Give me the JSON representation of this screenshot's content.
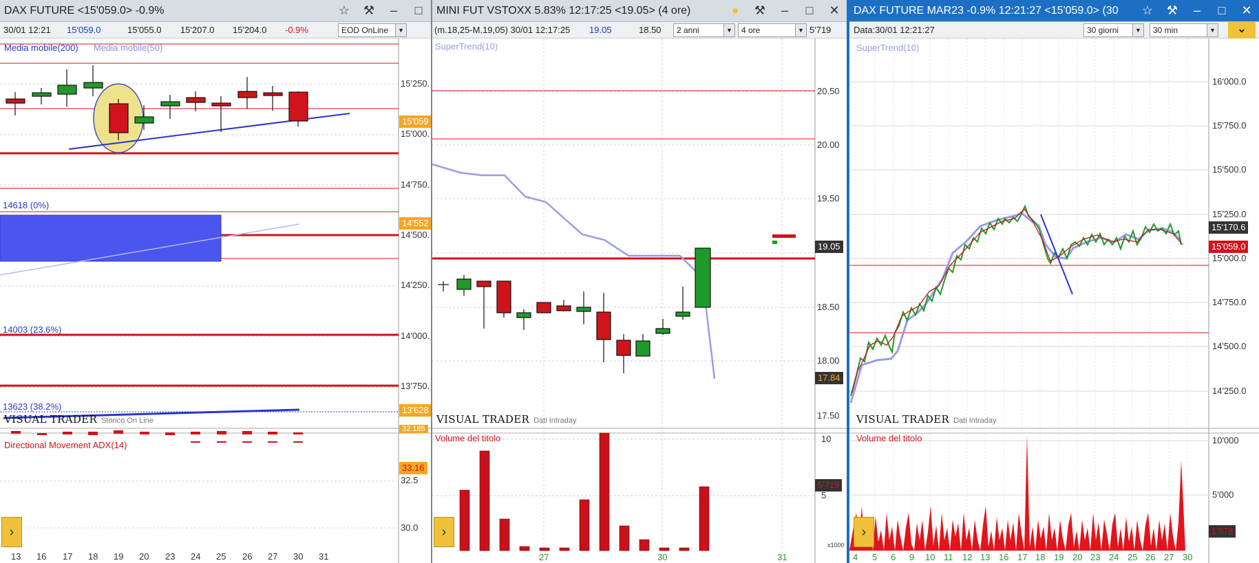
{
  "panels": {
    "dax": {
      "title": "DAX FUTURE <15'059.0> -0.9%",
      "info": {
        "date": "30/01 12:21",
        "last": "15'059.0",
        "v2": "15'055.0",
        "v3": "15'207.0",
        "v4": "15'204.0",
        "change": "-0.9%"
      },
      "source_select": "EOD OnLine",
      "indicator_ma200": "Media mobile(200)",
      "indicator_ma50": "Media mobile(50)",
      "fib_labels": [
        "14618 (0%)",
        "14003 (23.6%)",
        "13623 (38.2%)"
      ],
      "y_ticks": [
        "15'250.",
        "15'000.",
        "14'750.",
        "14'500.",
        "14'250.",
        "14'000.",
        "13'750."
      ],
      "price_tags": [
        "15'059",
        "14'552",
        "13'628",
        "32.185",
        "33.16"
      ],
      "brand": "VISUAL TRADER",
      "brand_sub": "Storico On Line",
      "adx_label": "Directional Movement ADX(14)",
      "adx_ticks": [
        "32.5",
        "30.0"
      ],
      "x_ticks": [
        "13",
        "16",
        "17",
        "18",
        "19",
        "20",
        "23",
        "24",
        "25",
        "26",
        "27",
        "30",
        "31"
      ]
    },
    "vstoxx": {
      "title": "MINI FUT VSTOXX 5.83% 12:17:25 <19.05> (4 ore)",
      "info": {
        "range": "(m.18,25-M.19,05) 30/01 12:17:25",
        "last": "19.05",
        "prev": "18.50"
      },
      "period_select": "2 anni",
      "interval_select": "4 ore",
      "volume_value": "5'719",
      "supertrend": "SuperTrend(10)",
      "y_ticks": [
        "20.50",
        "20.00",
        "19.50",
        "18.50",
        "18.00",
        "17.50"
      ],
      "price_tags": [
        "19.05",
        "17.84",
        "5'719"
      ],
      "brand": "VISUAL TRADER",
      "brand_sub": "Dati Intraday",
      "volume_label": "Volume del titolo",
      "vol_ticks": [
        "10",
        "5"
      ],
      "vol_unit": "x1000",
      "x_ticks": [
        "27",
        "30",
        "31"
      ]
    },
    "dax_mar23": {
      "title": "DAX FUTURE MAR23 -0.9% 12:21:27 <15'059.0> (30",
      "info": {
        "date": "Data:30/01 12:21:27"
      },
      "period_select": "30 giorni",
      "interval_select": "30 min",
      "supertrend": "SuperTrend(10)",
      "y_ticks": [
        "16'000.0",
        "15'750.0",
        "15'500.0",
        "15'250.0",
        "15'000.0",
        "14'750.0",
        "14'500.0",
        "14'250.0"
      ],
      "price_tags": [
        "15'170.6",
        "15'059.0",
        "1'578"
      ],
      "brand": "VISUAL TRADER",
      "brand_sub": "Dati Intraday",
      "volume_label": "Volume del titolo",
      "vol_ticks": [
        "10'000",
        "5'000"
      ],
      "x_ticks": [
        "4",
        "5",
        "6",
        "9",
        "10",
        "11",
        "12",
        "13",
        "16",
        "17",
        "18",
        "19",
        "20",
        "23",
        "24",
        "25",
        "26",
        "27",
        "30"
      ]
    }
  },
  "icons": [
    "star-icon",
    "hammer-icon",
    "minimize-icon",
    "maximize-icon",
    "close-icon",
    "chevron-right-icon",
    "chevron-down-icon"
  ],
  "colors": {
    "bull": "#1f9a2a",
    "bear": "#d0141b",
    "supertrend": "#9a9be8",
    "trendline": "#2a36c8",
    "fib_zone": "#4b55f0",
    "active_title": "#1d6fc4",
    "tag_orange": "#f6a623"
  }
}
